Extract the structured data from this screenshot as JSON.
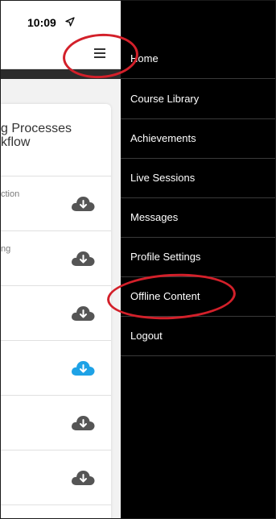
{
  "status": {
    "time": "10:09",
    "location_icon": "location-arrow-icon"
  },
  "app": {
    "menu_icon": "hamburger-menu-icon",
    "course_title": "g Processes\nkflow",
    "rows": [
      {
        "label": "ction",
        "icon": "cloud-download-icon",
        "color": "#555555"
      },
      {
        "label": "ng",
        "icon": "cloud-download-icon",
        "color": "#555555"
      },
      {
        "label": "",
        "icon": "cloud-download-icon",
        "color": "#555555"
      },
      {
        "label": "",
        "icon": "cloud-download-icon",
        "color": "#1ea2e6"
      },
      {
        "label": "",
        "icon": "cloud-download-icon",
        "color": "#555555"
      },
      {
        "label": "",
        "icon": "cloud-download-icon",
        "color": "#555555"
      }
    ]
  },
  "drawer": {
    "items": [
      {
        "label": "Home"
      },
      {
        "label": "Course Library"
      },
      {
        "label": "Achievements"
      },
      {
        "label": "Live Sessions"
      },
      {
        "label": "Messages"
      },
      {
        "label": "Profile Settings"
      },
      {
        "label": "Offline Content"
      },
      {
        "label": "Logout"
      }
    ]
  },
  "colors": {
    "drawer_bg": "#000000",
    "annotation": "#d3202a",
    "cloud_active": "#1ea2e6",
    "cloud_default": "#555555"
  }
}
